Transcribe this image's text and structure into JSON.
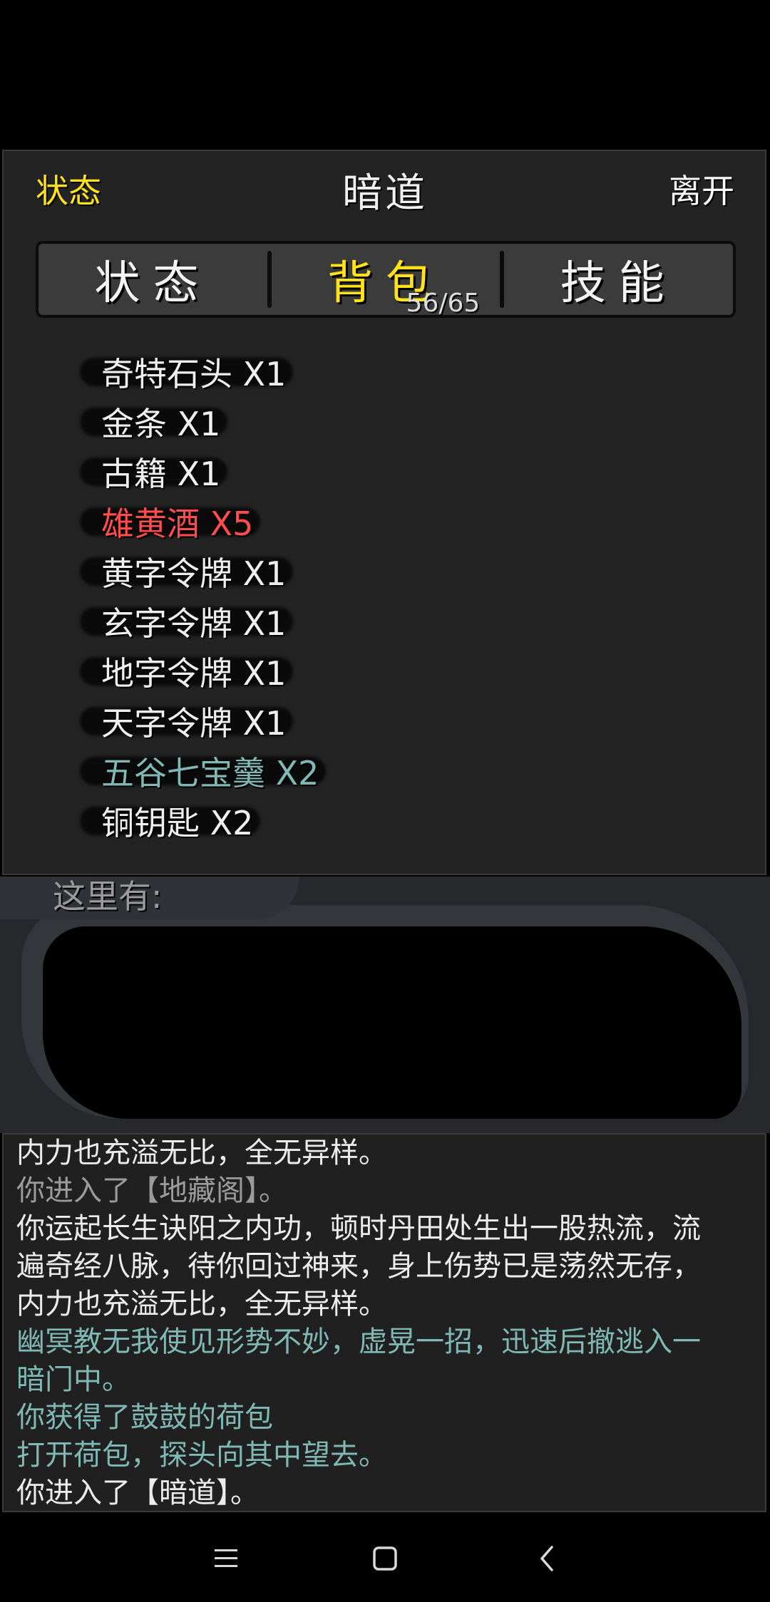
{
  "header": {
    "left_label": "状态",
    "title": "暗道",
    "right_label": "离开"
  },
  "tabs": [
    {
      "label": "状态",
      "active": false
    },
    {
      "label": "背包",
      "active": true
    },
    {
      "label": "技能",
      "active": false
    }
  ],
  "inventory_count": "56/65",
  "inventory": [
    {
      "text": "奇特石头 X1",
      "color": "#efefef"
    },
    {
      "text": "金条 X1",
      "color": "#efefef"
    },
    {
      "text": "古籍 X1",
      "color": "#efefef"
    },
    {
      "text": "雄黄酒 X5",
      "color": "#ff4c4c"
    },
    {
      "text": "黄字令牌 X1",
      "color": "#efefef"
    },
    {
      "text": "玄字令牌 X1",
      "color": "#efefef"
    },
    {
      "text": "地字令牌 X1",
      "color": "#efefef"
    },
    {
      "text": "天字令牌 X1",
      "color": "#efefef"
    },
    {
      "text": "五谷七宝羹 X2",
      "color": "#7fb8b4"
    },
    {
      "text": "铜钥匙 X2",
      "color": "#efefef"
    }
  ],
  "scene": {
    "label": "这里有:"
  },
  "log": [
    {
      "text": "内力也充溢无比，全无异样。",
      "style": "normal"
    },
    {
      "text": "你进入了【地藏阁】。",
      "style": "grey"
    },
    {
      "text": "你运起长生诀阳之内功，顿时丹田处生出一股热流，流",
      "style": "normal"
    },
    {
      "text": "遍奇经八脉，待你回过神来，身上伤势已是荡然无存，",
      "style": "normal"
    },
    {
      "text": "内力也充溢无比，全无异样。",
      "style": "normal"
    },
    {
      "text": "幽冥教无我使见形势不妙，虚晃一招，迅速后撤逃入一",
      "style": "teal"
    },
    {
      "text": "暗门中。",
      "style": "teal"
    },
    {
      "text": "你获得了鼓鼓的荷包",
      "style": "teal"
    },
    {
      "text": "打开荷包，探头向其中望去。",
      "style": "teal"
    },
    {
      "text": "你进入了【暗道】。",
      "style": "normal"
    }
  ],
  "navbar": {
    "icons": [
      "menu-icon",
      "home-square-icon",
      "back-chevron-icon"
    ]
  }
}
